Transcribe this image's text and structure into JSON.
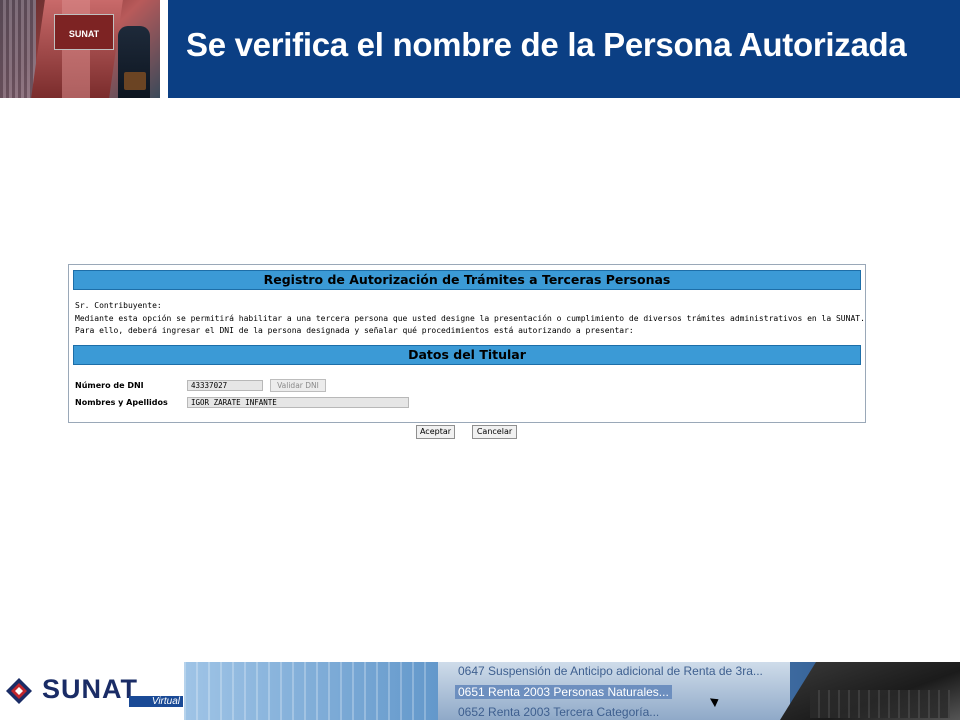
{
  "slide": {
    "title": "Se verifica el nombre de la Persona Autorizada",
    "header_photo_sign": "SUNAT"
  },
  "form": {
    "header": "Registro de Autorización de Trámites a Terceras Personas",
    "intro": [
      "Sr. Contribuyente:",
      "Mediante esta opción se permitirá habilitar a una tercera persona que usted designe la presentación o cumplimiento de diversos trámites administrativos en la SUNAT.",
      "Para ello, deberá ingresar el DNI de la persona designada y señalar qué procedimientos está autorizando a presentar:"
    ],
    "section_title": "Datos del Titular",
    "dni_label": "Número de DNI",
    "dni_value": "43337027",
    "validate_button": "Validar DNI",
    "name_label": "Nombres y Apellidos",
    "name_value": "IGOR ZARATE INFANTE"
  },
  "actions": {
    "accept": "Aceptar",
    "cancel": "Cancelar"
  },
  "footer": {
    "logo_text": "SUNAT",
    "logo_sub": "Virtual",
    "menu_lines": [
      "0647 Suspensión de Anticipo adicional de Renta de 3ra...",
      "0651 Renta 2003 Personas Naturales...",
      "0652 Renta 2003 Tercera Categoría..."
    ],
    "colors": {
      "brand_blue": "#0b3f84",
      "band_blue": "#3b9ad6",
      "logo_red": "#c0262d"
    }
  }
}
